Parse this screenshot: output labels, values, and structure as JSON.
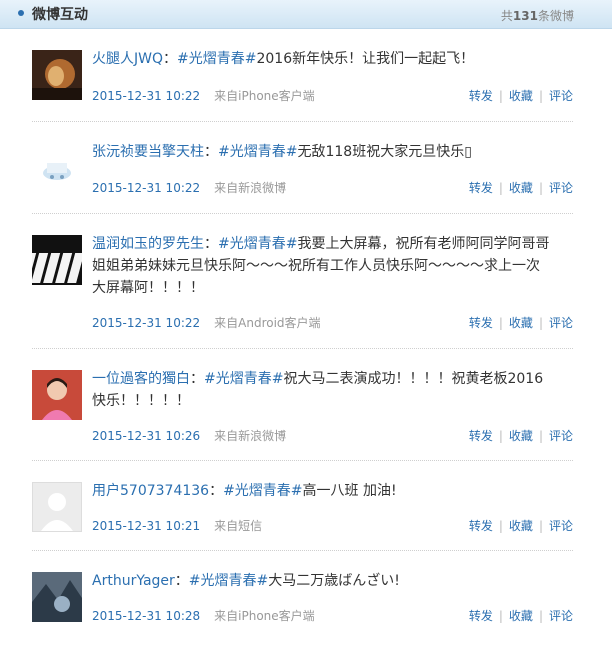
{
  "header": {
    "title": "微博互动",
    "count_prefix": "共",
    "count": "131",
    "count_suffix": "条微博"
  },
  "actions": {
    "repost": "转发",
    "favorite": "收藏",
    "comment": "评论",
    "sep": "|"
  },
  "posts": [
    {
      "author": "火腿人JWQ",
      "colon": "：",
      "tag": "#光熠青春#",
      "text": "2016新年快乐！让我们一起起飞！",
      "date": "2015-12-31 10:22",
      "source": "来自iPhone客户端"
    },
    {
      "author": "张沅祯要当擎天柱",
      "colon": "：",
      "tag": "#光熠青春#",
      "text": "无敌118班祝大家元旦快乐▯",
      "date": "2015-12-31 10:22",
      "source": "来自新浪微博"
    },
    {
      "author": "温润如玉的罗先生",
      "colon": "：",
      "tag": "#光熠青春#",
      "text": "我要上大屏幕，祝所有老师阿同学阿哥哥姐姐弟弟妹妹元旦快乐阿～～～祝所有工作人员快乐阿～～～～求上一次大屏幕阿！！！！",
      "date": "2015-12-31 10:22",
      "source": "来自Android客户端"
    },
    {
      "author": "一位過客的獨白",
      "colon": "：",
      "tag": "#光熠青春#",
      "text": "祝大马二表演成功！！！！祝黄老板2016快乐！！！！！",
      "date": "2015-12-31 10:26",
      "source": "来自新浪微博"
    },
    {
      "author": "用户5707374136",
      "colon": "：",
      "tag": "#光熠青春#",
      "text": "高一八班 加油!",
      "date": "2015-12-31 10:21",
      "source": "来自短信"
    },
    {
      "author": "ArthurYager",
      "colon": "：",
      "tag": "#光熠青春#",
      "text": "大马二万歳ばんざい!",
      "date": "2015-12-31 10:28",
      "source": "来自iPhone客户端"
    }
  ]
}
